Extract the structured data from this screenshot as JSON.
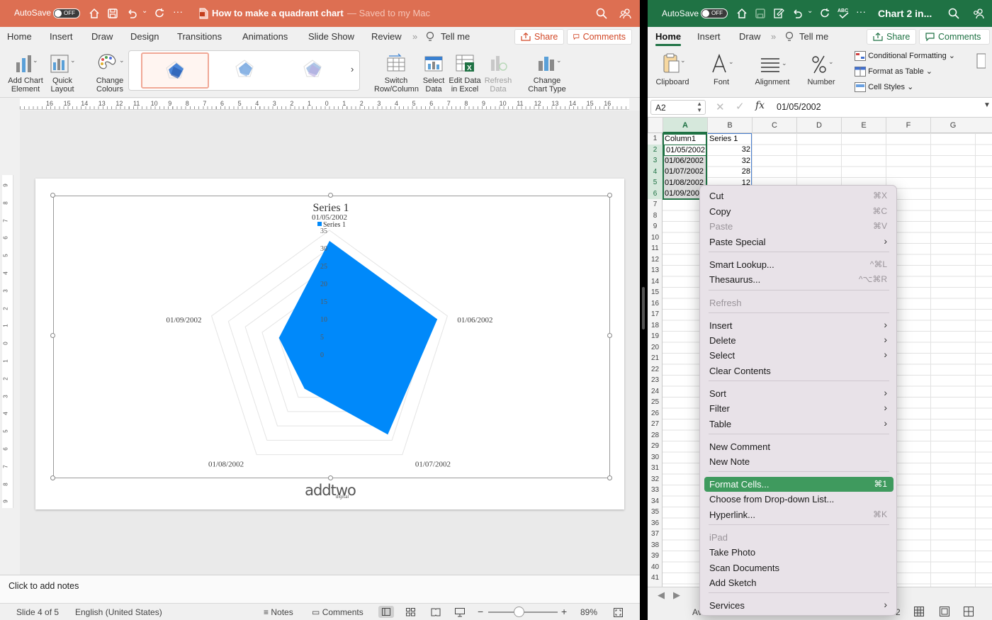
{
  "ppt": {
    "title_bar": {
      "autosave": "AutoSave",
      "toggle": "OFF",
      "doc_title": "How to make a quadrant chart",
      "saved_status": "— Saved to my Mac"
    },
    "menu_tabs": [
      "Home",
      "Insert",
      "Draw",
      "Design",
      "Transitions",
      "Animations",
      "Slide Show",
      "Review"
    ],
    "tell_me": "Tell me",
    "share": "Share",
    "comments": "Comments",
    "ribbon": {
      "add_chart_element": [
        "Add Chart",
        "Element"
      ],
      "quick_layout": [
        "Quick",
        "Layout"
      ],
      "change_colours": [
        "Change",
        "Colours"
      ],
      "switch_row_column": [
        "Switch",
        "Row/Column"
      ],
      "select_data": [
        "Select",
        "Data"
      ],
      "edit_data": [
        "Edit Data",
        "in Excel"
      ],
      "refresh_data": [
        "Refresh",
        "Data"
      ],
      "change_chart_type": [
        "Change",
        "Chart Type"
      ]
    },
    "hruler": [
      "16",
      "15",
      "14",
      "13",
      "12",
      "11",
      "10",
      "9",
      "8",
      "7",
      "6",
      "5",
      "4",
      "3",
      "2",
      "1",
      "0",
      "1",
      "2",
      "3",
      "4",
      "5",
      "6",
      "7",
      "8",
      "9",
      "10",
      "11",
      "12",
      "13",
      "14",
      "15",
      "16"
    ],
    "vruler": [
      "9",
      "8",
      "7",
      "6",
      "5",
      "4",
      "3",
      "2",
      "1",
      "0",
      "1",
      "2",
      "3",
      "4",
      "5",
      "6",
      "7",
      "8",
      "9"
    ],
    "notes_placeholder": "Click to add notes",
    "status": {
      "slide": "Slide 4 of 5",
      "language": "English (United States)",
      "notes": "Notes",
      "comments": "Comments",
      "zoom": "89%"
    },
    "logo": "addtwo",
    "logo_sub": "digital"
  },
  "chart_data": {
    "type": "radar",
    "title": "Series 1",
    "categories": [
      "01/05/2002",
      "01/06/2002",
      "01/07/2002",
      "01/08/2002",
      "01/09/2002"
    ],
    "series": [
      {
        "name": "Series 1",
        "values": [
          32,
          32,
          28,
          12,
          15
        ]
      }
    ],
    "ticks": [
      0,
      5,
      10,
      15,
      20,
      25,
      30,
      35
    ],
    "rlim": [
      0,
      35
    ],
    "legend": "top",
    "fill_color": "#0089fa"
  },
  "excel": {
    "title_bar": {
      "autosave": "AutoSave",
      "toggle": "OFF",
      "doc_title": "Chart 2 in..."
    },
    "menu_tabs": [
      "Home",
      "Insert",
      "Draw"
    ],
    "tell_me": "Tell me",
    "share": "Share",
    "comments": "Comments",
    "ribbon": {
      "clipboard": "Clipboard",
      "font": "Font",
      "alignment": "Alignment",
      "number": "Number",
      "conditional_formatting": "Conditional Formatting",
      "format_as_table": "Format as Table",
      "cell_styles": "Cell Styles"
    },
    "name_box": "A2",
    "formula": "01/05/2002",
    "columns": [
      "A",
      "B",
      "C",
      "D",
      "E",
      "F",
      "G"
    ],
    "rows": [
      "1",
      "2",
      "3",
      "4",
      "5",
      "6",
      "7",
      "8",
      "9",
      "10",
      "11",
      "12",
      "13",
      "14",
      "15",
      "16",
      "17",
      "18",
      "19",
      "20",
      "21",
      "22",
      "23",
      "24",
      "25",
      "26",
      "27",
      "28",
      "29",
      "30",
      "31",
      "32",
      "33",
      "34",
      "35",
      "36",
      "37",
      "38",
      "39",
      "40",
      "41"
    ],
    "cells": {
      "header_a": "Column1",
      "header_b": "Series 1",
      "dates": [
        "01/05/2002",
        "01/06/2002",
        "01/07/2002",
        "01/08/2002",
        "01/09/2002"
      ],
      "values": [
        "32",
        "32",
        "28",
        "12",
        "15"
      ]
    },
    "status_left": "Av",
    "status_right": "2"
  },
  "context_menu": {
    "items": [
      {
        "label": "Cut",
        "shortcut": "⌘X"
      },
      {
        "label": "Copy",
        "shortcut": "⌘C"
      },
      {
        "label": "Paste",
        "shortcut": "⌘V"
      },
      {
        "label": "Paste Special"
      },
      {
        "label": "Smart Lookup...",
        "shortcut": "^⌘L"
      },
      {
        "label": "Thesaurus...",
        "shortcut": "^⌥⌘R"
      },
      {
        "label": "Refresh"
      },
      {
        "label": "Insert"
      },
      {
        "label": "Delete"
      },
      {
        "label": "Select"
      },
      {
        "label": "Clear Contents"
      },
      {
        "label": "Sort"
      },
      {
        "label": "Filter"
      },
      {
        "label": "Table"
      },
      {
        "label": "New Comment"
      },
      {
        "label": "New Note"
      },
      {
        "label": "Format Cells...",
        "shortcut": "⌘1"
      },
      {
        "label": "Choose from Drop-down List..."
      },
      {
        "label": "Hyperlink...",
        "shortcut": "⌘K"
      },
      {
        "label": "iPad"
      },
      {
        "label": "Take Photo"
      },
      {
        "label": "Scan Documents"
      },
      {
        "label": "Add Sketch"
      },
      {
        "label": "Services"
      }
    ]
  }
}
